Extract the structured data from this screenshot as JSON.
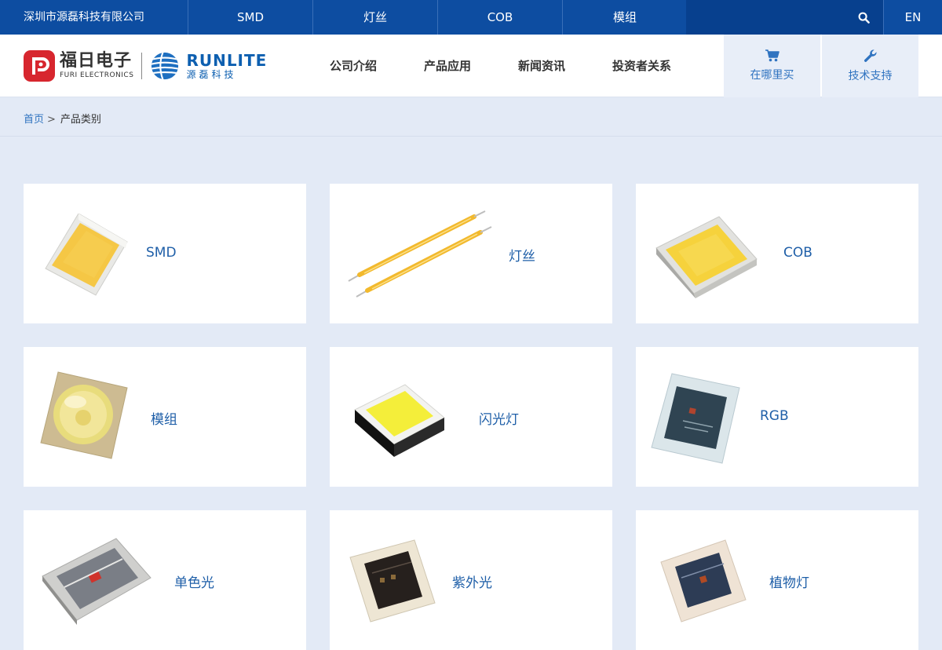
{
  "topbar": {
    "company": "深圳市源磊科技有限公司",
    "nav": [
      "SMD",
      "灯丝",
      "COB",
      "模组"
    ],
    "lang": "EN"
  },
  "brand": {
    "furi_cn": "福日电子",
    "furi_en": "FURI ELECTRONICS",
    "runlite_en": "RUNLITE",
    "runlite_cn": "源磊科技"
  },
  "mainnav": [
    "公司介绍",
    "产品应用",
    "新闻资讯",
    "投资者关系"
  ],
  "header_buttons": {
    "buy": "在哪里买",
    "support": "技术支持"
  },
  "breadcrumb": {
    "home": "首页",
    "separator": ">",
    "current": "产品类别"
  },
  "products": [
    {
      "name": "SMD"
    },
    {
      "name": "灯丝"
    },
    {
      "name": "COB"
    },
    {
      "name": "模组"
    },
    {
      "name": "闪光灯"
    },
    {
      "name": "RGB"
    },
    {
      "name": "单色光"
    },
    {
      "name": "紫外光"
    },
    {
      "name": "植物灯"
    }
  ],
  "colors": {
    "brand_blue": "#0d4da1",
    "accent_blue": "#2f73c0",
    "page_bg": "#e3eaf6",
    "furi_red": "#d7262e"
  }
}
